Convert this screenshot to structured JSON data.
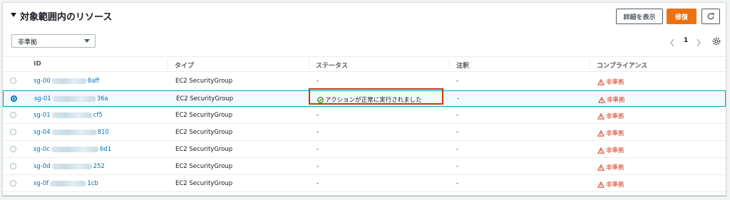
{
  "panel": {
    "title": "対象範囲内のリソース",
    "buttons": {
      "details": "詳細を表示",
      "remediate": "修復"
    }
  },
  "filter": {
    "selected": "非準拠"
  },
  "pagination": {
    "current_page": "1"
  },
  "columns": [
    "ID",
    "タイプ",
    "ステータス",
    "注釈",
    "コンプライアンス"
  ],
  "rows": [
    {
      "id_prefix": "sg-00",
      "id_suffix": "8aff",
      "type": "EC2 SecurityGroup",
      "status": "-",
      "note": "-",
      "compliance": "非準拠",
      "selected": false
    },
    {
      "id_prefix": "sg-01",
      "id_suffix": "36a",
      "type": "EC2 SecurityGroup",
      "status": "アクションが正常に実行されました",
      "note": "-",
      "compliance": "非準拠",
      "selected": true
    },
    {
      "id_prefix": "sg-01",
      "id_suffix": "cf5",
      "type": "EC2 SecurityGroup",
      "status": "-",
      "note": "-",
      "compliance": "非準拠",
      "selected": false
    },
    {
      "id_prefix": "sg-04",
      "id_suffix": "810",
      "type": "EC2 SecurityGroup",
      "status": "-",
      "note": "-",
      "compliance": "非準拠",
      "selected": false
    },
    {
      "id_prefix": "sg-0c",
      "id_suffix": "6d1",
      "type": "EC2 SecurityGroup",
      "status": "-",
      "note": "-",
      "compliance": "非準拠",
      "selected": false
    },
    {
      "id_prefix": "sg-0d",
      "id_suffix": "252",
      "type": "EC2 SecurityGroup",
      "status": "-",
      "note": "-",
      "compliance": "非準拠",
      "selected": false
    },
    {
      "id_prefix": "sg-0f",
      "id_suffix": "1cb",
      "type": "EC2 SecurityGroup",
      "status": "-",
      "note": "-",
      "compliance": "非準拠",
      "selected": false
    }
  ],
  "icons": {
    "collapse": "caret-down-icon",
    "refresh": "refresh-icon",
    "settings": "gear-icon",
    "success": "check-circle-icon",
    "warning": "warning-triangle-icon"
  },
  "colors": {
    "accent_orange": "#ec7211",
    "link_blue": "#0073bb",
    "error_red": "#d13212",
    "success_green": "#1d8102",
    "highlight_red": "#d13212"
  }
}
